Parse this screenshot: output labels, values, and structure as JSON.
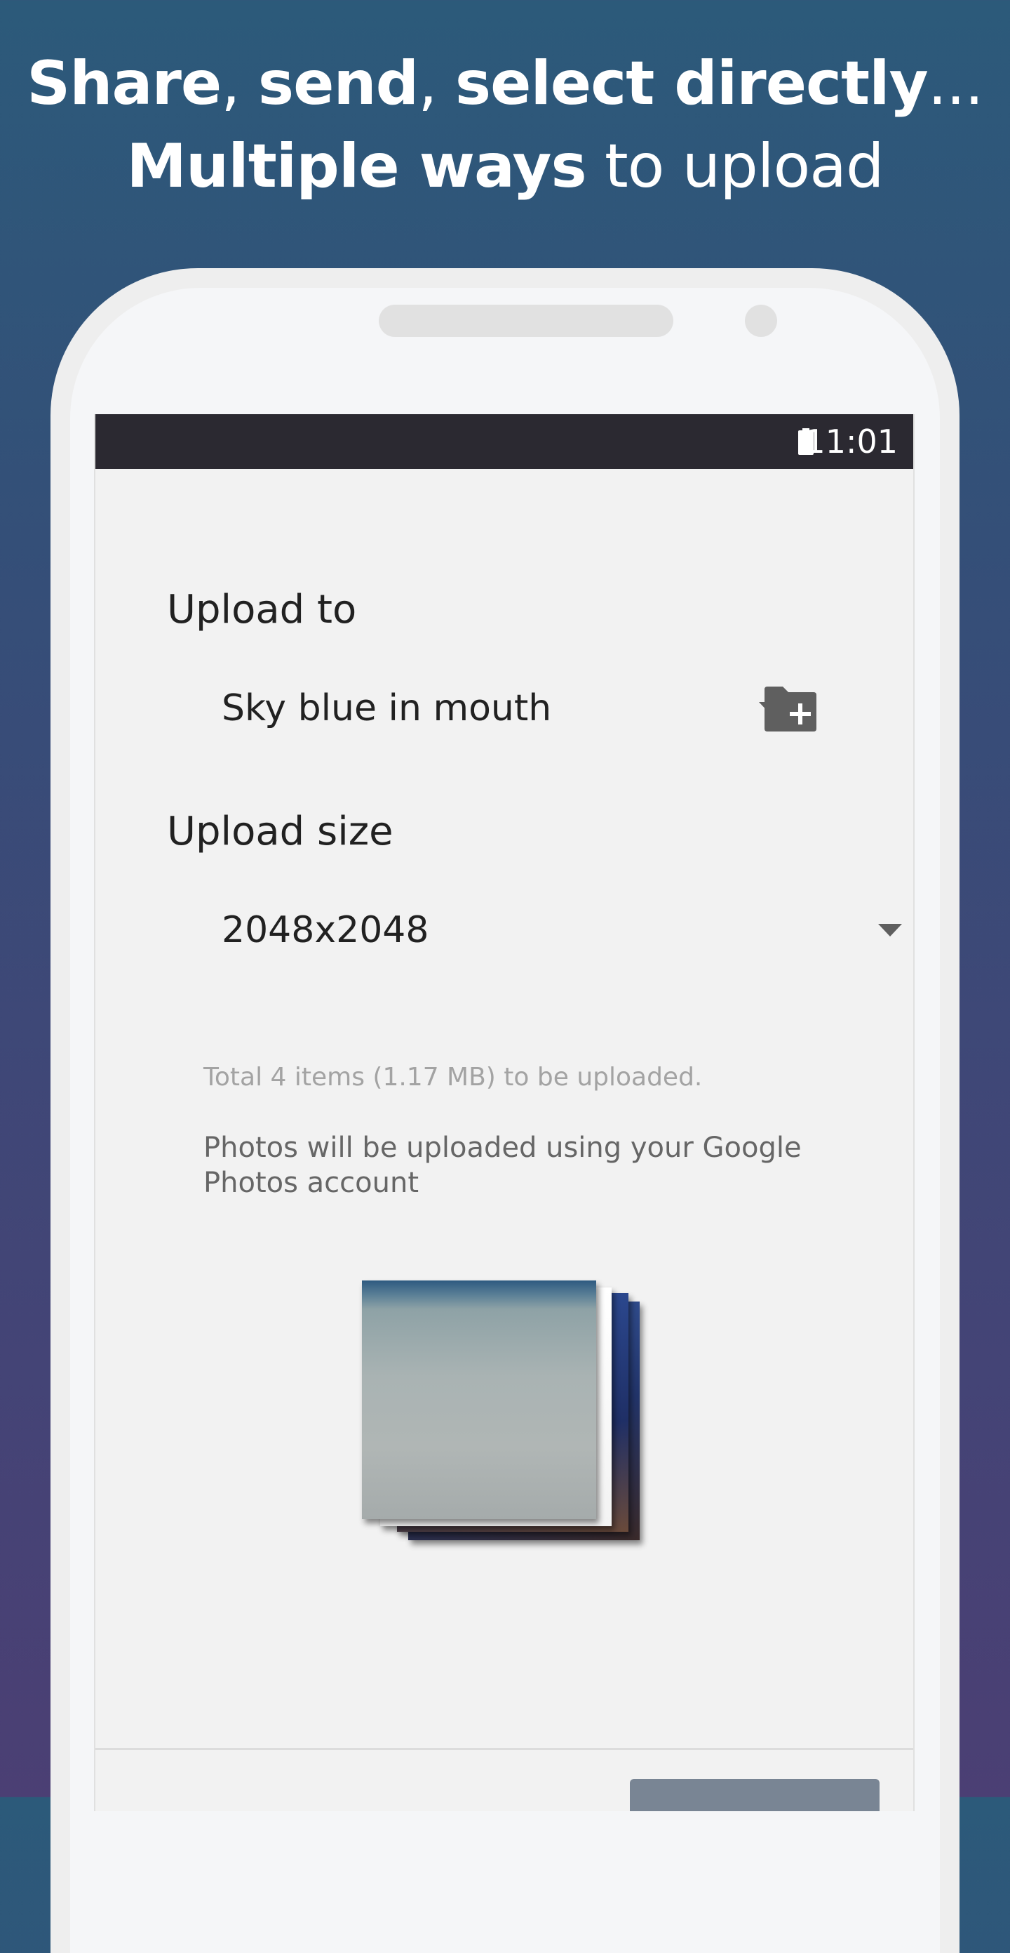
{
  "promo": {
    "line1_part1": "Share",
    "line1_sep1": ",",
    "line1_part2": "send",
    "line1_sep2": ",",
    "line1_part3": "select directly",
    "line1_ellipsis": "...",
    "line2_bold": "Multiple ways",
    "line2_light": " to upload"
  },
  "status_bar": {
    "time": "11:01",
    "battery_icon": "battery-full-icon"
  },
  "upload_form": {
    "upload_to_label": "Upload to",
    "album_selected": "Sky blue in mouth",
    "album_dropdown_icon": "dropdown-arrow-icon",
    "new_album_icon": "create-new-folder-icon",
    "upload_size_label": "Upload size",
    "size_selected": "2048x2048",
    "size_dropdown_icon": "dropdown-arrow-icon"
  },
  "info": {
    "summary": "Total 4 items (1.17 MB) to be uploaded.",
    "account_note": "Photos will be uploaded using your Google Photos account"
  },
  "preview": {
    "count": 4
  },
  "colors": {
    "background_top": "#2c5a7a",
    "background_bottom": "#4b3f74",
    "status_bar": "#2b2931",
    "upload_button": "#798594"
  }
}
